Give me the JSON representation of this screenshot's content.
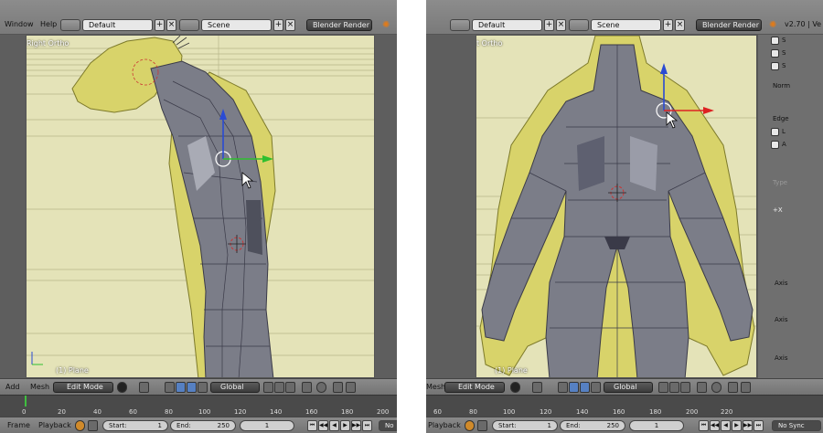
{
  "left": {
    "menu": {
      "window": "Window",
      "help": "Help"
    },
    "layout": "Default",
    "scene": "Scene",
    "render_engine": "Blender Render",
    "view_label": "Right Ortho",
    "object_label": "(1) Plane",
    "bottom": {
      "add": "Add",
      "mesh": "Mesh",
      "mode": "Edit Mode",
      "orientation": "Global"
    },
    "timeline_ticks": [
      "0",
      "20",
      "40",
      "60",
      "80",
      "100",
      "120",
      "140",
      "160",
      "180",
      "200"
    ],
    "footer": {
      "frame": "Frame",
      "playback": "Playback",
      "start": "Start:",
      "start_val": "1",
      "end": "End:",
      "end_val": "250",
      "current": "1",
      "nosync": "No"
    }
  },
  "right": {
    "layout": "Default",
    "scene": "Scene",
    "render_engine": "Blender Render",
    "version": "v2.70 | Ve",
    "view_label": "t Ortho",
    "object_label": "(1) Plane",
    "bottom": {
      "mesh": "Mesh",
      "mode": "Edit Mode",
      "orientation": "Global"
    },
    "timeline_ticks": [
      "60",
      "80",
      "100",
      "120",
      "140",
      "160",
      "180",
      "200",
      "220"
    ],
    "footer": {
      "playback": "Playback",
      "start": "Start:",
      "start_val": "1",
      "end": "End:",
      "end_val": "250",
      "current": "1",
      "nosync": "No Sync"
    },
    "side_panel": [
      "S",
      "S",
      "S",
      "Norm",
      "Edge",
      "L",
      "A",
      "Type",
      "+X",
      "Axis",
      "Axis",
      "Axis"
    ]
  },
  "colors": {
    "viewport_bg": "#e4e3b8",
    "mesh": "#7b7d88",
    "sketch": "#d8d36a",
    "accent": "#5680c2"
  }
}
